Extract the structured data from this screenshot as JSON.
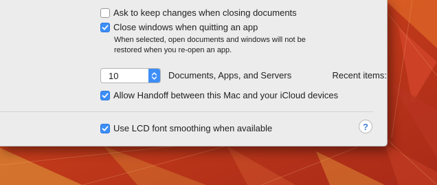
{
  "window": {
    "ask_keep_changes": {
      "label": "Ask to keep changes when closing documents",
      "checked": false
    },
    "close_windows": {
      "label": "Close windows when quitting an app",
      "checked": true
    },
    "close_windows_help": [
      "When selected, open documents and windows will not be",
      "restored when you re-open an app."
    ],
    "recent_items": {
      "label": "Recent items:",
      "value": "10",
      "suffix": "Documents, Apps, and Servers"
    },
    "handoff": {
      "label": "Allow Handoff between this Mac and your iCloud devices",
      "checked": true
    },
    "lcd_smoothing": {
      "label": "Use LCD font smoothing when available",
      "checked": true
    },
    "help_button": "?"
  },
  "colors": {
    "accent": "#3d8ef7",
    "window_bg": "#ececec",
    "wallpaper": "#c8401d"
  },
  "icons": [
    "checkmark-icon",
    "popup-arrows-icon",
    "help-icon"
  ]
}
